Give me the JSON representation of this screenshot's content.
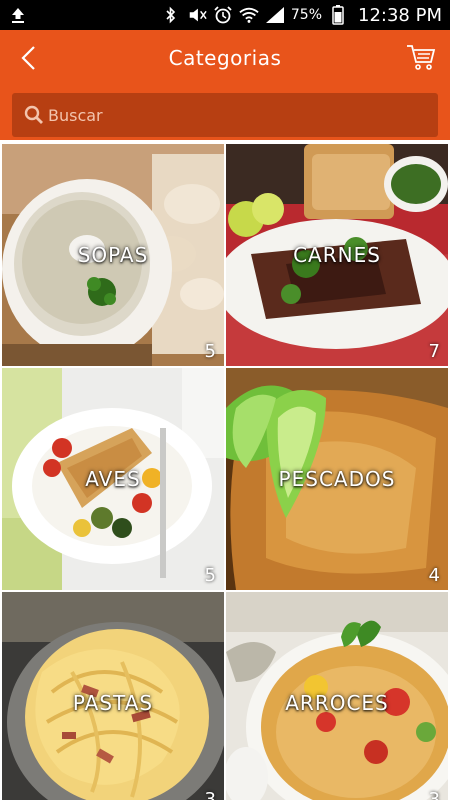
{
  "status_bar": {
    "battery": "75%",
    "time": "12:38 PM"
  },
  "header": {
    "title": "Categorias",
    "back_icon": "chevron-left-icon",
    "cart_icon": "cart-icon"
  },
  "search": {
    "placeholder": "Buscar"
  },
  "categories": [
    {
      "label": "SOPAS",
      "count": "5"
    },
    {
      "label": "CARNES",
      "count": "7"
    },
    {
      "label": "AVES",
      "count": "5"
    },
    {
      "label": "PESCADOS",
      "count": "4"
    },
    {
      "label": "PASTAS",
      "count": "3"
    },
    {
      "label": "ARROCES",
      "count": "3"
    }
  ],
  "colors": {
    "accent": "#e8541b",
    "search_bg": "#b73f12"
  }
}
